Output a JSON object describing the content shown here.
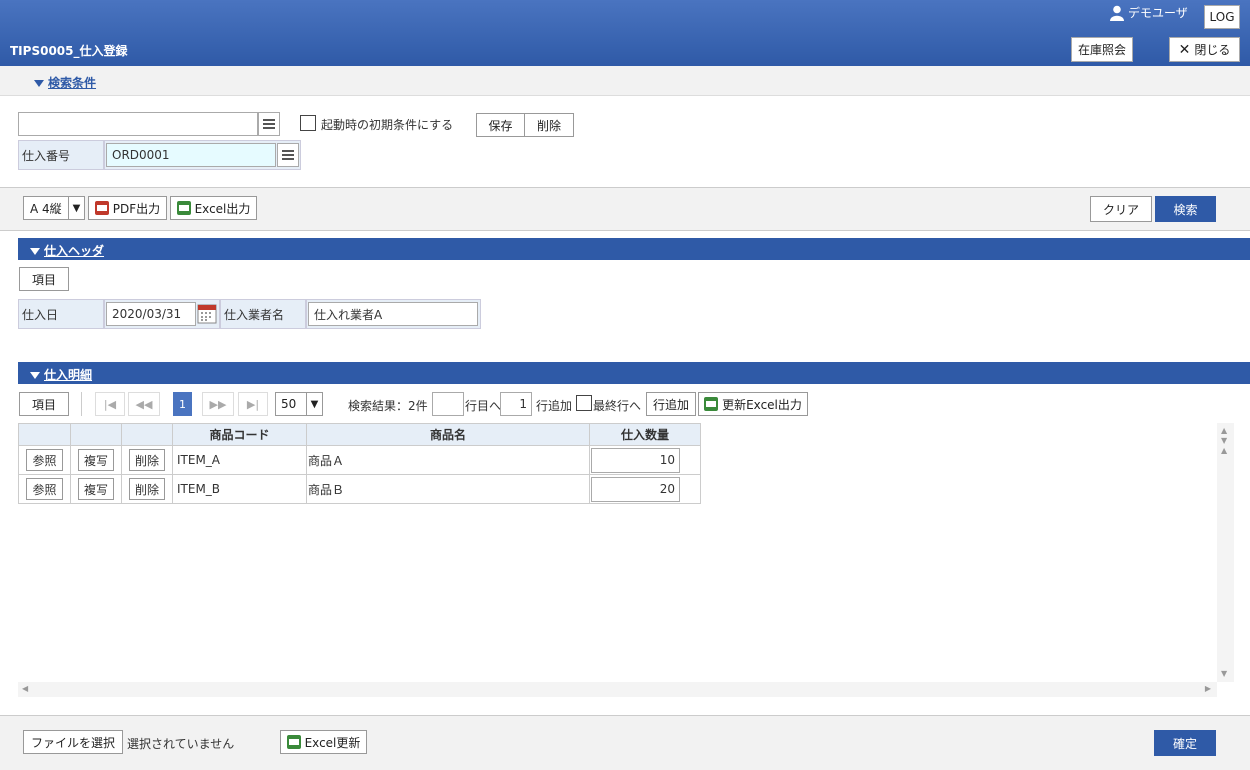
{
  "header": {
    "screen_title": "TIPS0005_仕入登録",
    "user_name": "デモユーザ",
    "logout_label": "LOG",
    "stock_button": "在庫照会",
    "close_button": "閉じる"
  },
  "search": {
    "section_title": "検索条件",
    "condition_input_value": "",
    "startup_checkbox_label": "起動時の初期条件にする",
    "save_button": "保存",
    "delete_button": "削除",
    "order_number_label": "仕入番号",
    "order_number_value": "ORD0001"
  },
  "toolbar": {
    "paper_select": "A 4縦",
    "pdf_button": "PDF出力",
    "excel_button": "Excel出力",
    "clear_button": "クリア",
    "search_button": "検索"
  },
  "purchase_header": {
    "section_title": "仕入ヘッダ",
    "item_button": "項目",
    "date_label": "仕入日",
    "date_value": "2020/03/31",
    "supplier_label": "仕入業者名",
    "supplier_value": "仕入れ業者A"
  },
  "details": {
    "section_title": "仕入明細",
    "item_button": "項目",
    "current_page": "1",
    "page_size": "50",
    "result_text": "検索結果：2件",
    "goto_row_value": "",
    "goto_row_label": "行目へ",
    "add_rows_value": "1",
    "add_rows_label": "行追加",
    "last_row_label": "最終行へ",
    "add_row_button": "行追加",
    "update_excel_button": "更新Excel出力",
    "columns": [
      "商品コード",
      "商品名",
      "仕入数量"
    ],
    "row_buttons": {
      "ref": "参照",
      "copy": "複写",
      "delete": "削除"
    },
    "rows": [
      {
        "code": "ITEM_A",
        "name": "商品Ａ",
        "qty": "10"
      },
      {
        "code": "ITEM_B",
        "name": "商品Ｂ",
        "qty": "20"
      }
    ]
  },
  "footer": {
    "file_button": "ファイルを選択",
    "file_status": "選択されていません",
    "excel_update_button": "Excel更新",
    "confirm_button": "確定"
  },
  "colors": {
    "brand_blue": "#2f5aa7",
    "label_bg": "#e6eef7",
    "highlight_input": "#e6fbff"
  }
}
